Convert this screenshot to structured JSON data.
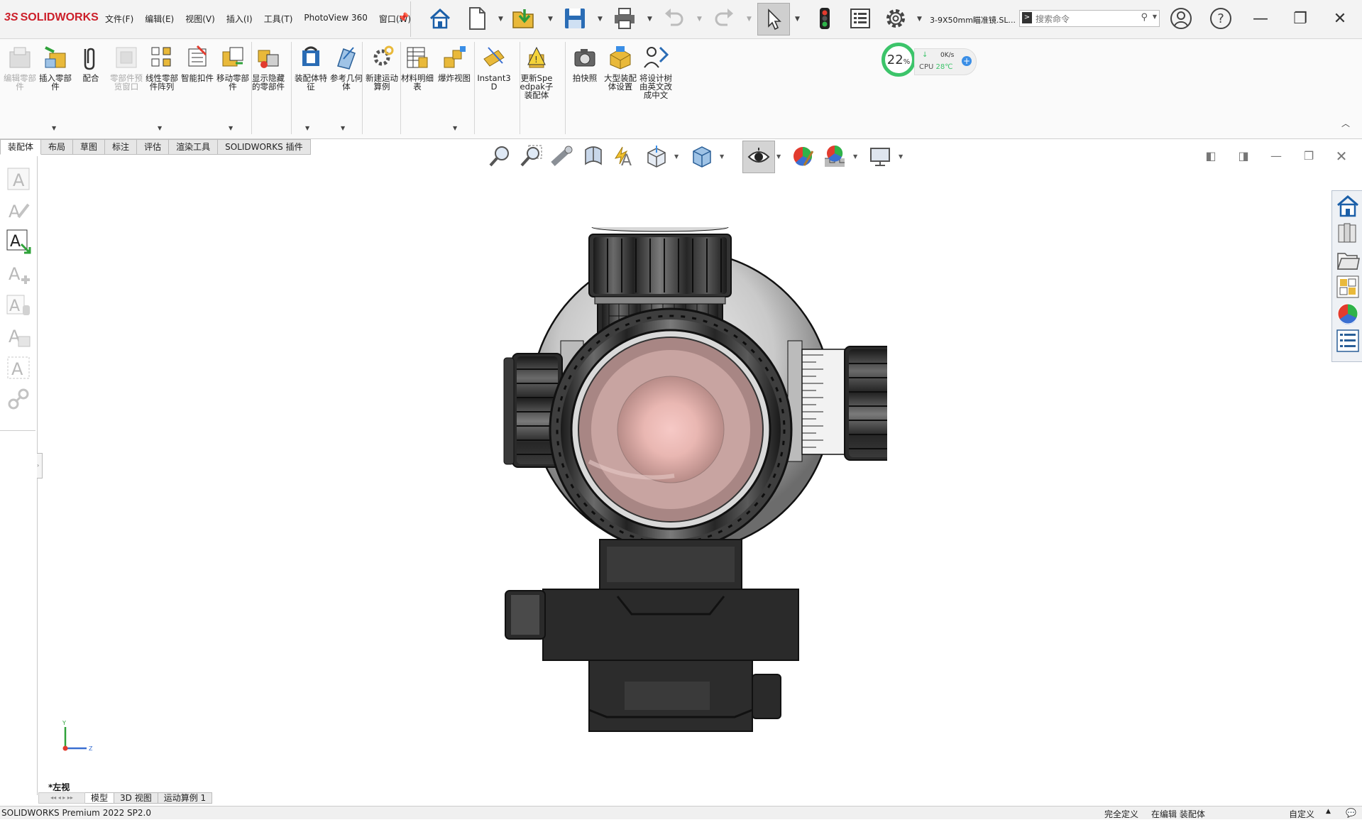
{
  "app": {
    "brand_mark": "3S",
    "brand_name": "SOLIDWORKS",
    "document_title": "3-9X50mm瞄准镜.SL...",
    "edition": "SOLIDWORKS Premium 2022 SP2.0"
  },
  "menu": [
    "文件(F)",
    "编辑(E)",
    "视图(V)",
    "插入(I)",
    "工具(T)",
    "PhotoView 360",
    "窗口(W)"
  ],
  "search": {
    "placeholder": "搜索命令"
  },
  "cpu_widget": {
    "percent": "22",
    "percent_unit": "%",
    "speed": "0K/s",
    "cpu_label": "CPU",
    "temperature": "28℃"
  },
  "ribbon": [
    {
      "id": "edit-part",
      "label": "编辑零部件",
      "enabled": false
    },
    {
      "id": "insert-component",
      "label": "插入零部件",
      "enabled": true
    },
    {
      "id": "mate",
      "label": "配合",
      "enabled": true
    },
    {
      "id": "component-preview",
      "label": "零部件预览窗口",
      "enabled": false
    },
    {
      "id": "linear-pattern",
      "label": "线性零部件阵列",
      "enabled": true
    },
    {
      "id": "smart-fasteners",
      "label": "智能扣件",
      "enabled": true
    },
    {
      "id": "move-component",
      "label": "移动零部件",
      "enabled": true
    },
    {
      "id": "show-hidden",
      "label": "显示隐藏的零部件",
      "enabled": true
    },
    {
      "id": "assembly-features",
      "label": "装配体特征",
      "enabled": true
    },
    {
      "id": "reference-geometry",
      "label": "参考几何体",
      "enabled": true
    },
    {
      "id": "new-motion-study",
      "label": "新建运动算例",
      "enabled": true
    },
    {
      "id": "bom",
      "label": "材料明细表",
      "enabled": true
    },
    {
      "id": "exploded-view",
      "label": "爆炸视图",
      "enabled": true
    },
    {
      "id": "instant3d",
      "label": "Instant3D",
      "enabled": true
    },
    {
      "id": "update-speedpak",
      "label": "更新Speedpak子装配体",
      "enabled": true
    },
    {
      "id": "take-snapshot",
      "label": "拍快照",
      "enabled": true
    },
    {
      "id": "large-assembly",
      "label": "大型装配体设置",
      "enabled": true
    },
    {
      "id": "translate-tree",
      "label": "将设计树由英文改成中文",
      "enabled": true
    }
  ],
  "command_tabs": [
    "装配体",
    "布局",
    "草图",
    "标注",
    "评估",
    "渲染工具",
    "SOLIDWORKS 插件"
  ],
  "active_command_tab": "装配体",
  "view_label": "*左视",
  "bottom_tabs": [
    "模型",
    "3D 视图",
    "运动算例 1"
  ],
  "triad": {
    "y": "Y",
    "z": "Z"
  },
  "status": {
    "defined": "完全定义",
    "editing": "在编辑 装配体",
    "custom": "自定义"
  },
  "icons": {
    "home": "home-icon",
    "new": "new-document-icon",
    "open": "open-icon",
    "save": "save-icon",
    "print": "print-icon",
    "undo": "undo-icon",
    "redo": "redo-icon",
    "select": "select-cursor-icon",
    "rebuild": "traffic-light-icon",
    "file-props": "file-properties-icon",
    "options": "gear-icon",
    "user": "user-icon",
    "help": "help-icon"
  },
  "colors": {
    "brand": "#cc1f2a",
    "cpu_ring": "#3cc46a",
    "accent_blue": "#3a8ee6"
  }
}
